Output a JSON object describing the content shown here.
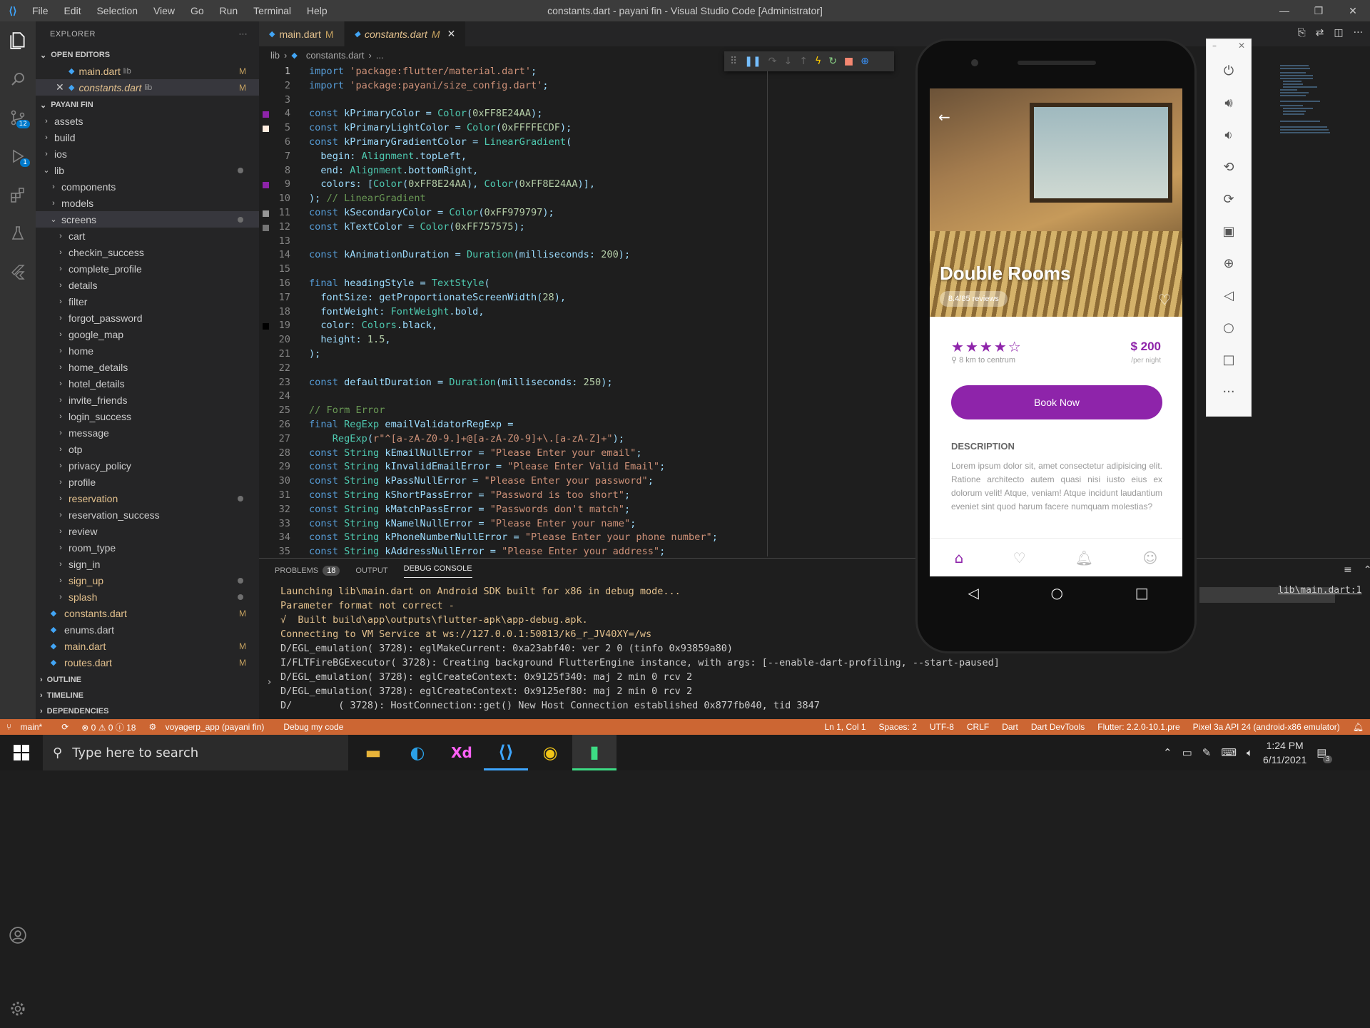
{
  "titlebar": {
    "menu": [
      "File",
      "Edit",
      "Selection",
      "View",
      "Go",
      "Run",
      "Terminal",
      "Help"
    ],
    "title": "constants.dart - payani fin - Visual Studio Code [Administrator]"
  },
  "explorer": {
    "header": "EXPLORER",
    "open_editors_label": "OPEN EDITORS",
    "open_editors": [
      {
        "name": "main.dart",
        "dir": "lib",
        "mark": "M"
      },
      {
        "name": "constants.dart",
        "dir": "lib",
        "mark": "M"
      }
    ],
    "project_label": "PAYANI FIN",
    "tree": [
      {
        "name": "assets",
        "folder": true,
        "level": 0
      },
      {
        "name": "build",
        "folder": true,
        "level": 0
      },
      {
        "name": "ios",
        "folder": true,
        "level": 0
      },
      {
        "name": "lib",
        "folder": true,
        "level": 0,
        "open": true,
        "dot": true
      },
      {
        "name": "components",
        "folder": true,
        "level": 1
      },
      {
        "name": "models",
        "folder": true,
        "level": 1
      },
      {
        "name": "screens",
        "folder": true,
        "level": 1,
        "open": true,
        "dot": true,
        "selected": true
      },
      {
        "name": "cart",
        "folder": true,
        "level": 2
      },
      {
        "name": "checkin_success",
        "folder": true,
        "level": 2
      },
      {
        "name": "complete_profile",
        "folder": true,
        "level": 2
      },
      {
        "name": "details",
        "folder": true,
        "level": 2
      },
      {
        "name": "filter",
        "folder": true,
        "level": 2
      },
      {
        "name": "forgot_password",
        "folder": true,
        "level": 2
      },
      {
        "name": "google_map",
        "folder": true,
        "level": 2
      },
      {
        "name": "home",
        "folder": true,
        "level": 2
      },
      {
        "name": "home_details",
        "folder": true,
        "level": 2
      },
      {
        "name": "hotel_details",
        "folder": true,
        "level": 2
      },
      {
        "name": "invite_friends",
        "folder": true,
        "level": 2
      },
      {
        "name": "login_success",
        "folder": true,
        "level": 2
      },
      {
        "name": "message",
        "folder": true,
        "level": 2
      },
      {
        "name": "otp",
        "folder": true,
        "level": 2
      },
      {
        "name": "privacy_policy",
        "folder": true,
        "level": 2
      },
      {
        "name": "profile",
        "folder": true,
        "level": 2
      },
      {
        "name": "reservation",
        "folder": true,
        "level": 2,
        "dot": true,
        "gold": true
      },
      {
        "name": "reservation_success",
        "folder": true,
        "level": 2
      },
      {
        "name": "review",
        "folder": true,
        "level": 2
      },
      {
        "name": "room_type",
        "folder": true,
        "level": 2
      },
      {
        "name": "sign_in",
        "folder": true,
        "level": 2
      },
      {
        "name": "sign_up",
        "folder": true,
        "level": 2,
        "dot": true,
        "gold": true
      },
      {
        "name": "splash",
        "folder": true,
        "level": 2,
        "dot": true,
        "gold": true
      },
      {
        "name": "constants.dart",
        "folder": false,
        "level": 1,
        "mark": "M",
        "gold": true
      },
      {
        "name": "enums.dart",
        "folder": false,
        "level": 1
      },
      {
        "name": "main.dart",
        "folder": false,
        "level": 1,
        "mark": "M",
        "gold": true
      },
      {
        "name": "routes.dart",
        "folder": false,
        "level": 1,
        "mark": "M",
        "gold": true
      }
    ],
    "bottom_sections": [
      "OUTLINE",
      "TIMELINE",
      "DEPENDENCIES"
    ]
  },
  "tabs": [
    {
      "name": "main.dart",
      "mark": "M"
    },
    {
      "name": "constants.dart",
      "mark": "M",
      "active": true
    }
  ],
  "breadcrumb": [
    "lib",
    "constants.dart",
    "..."
  ],
  "code_lines": [
    "import 'package:flutter/material.dart';",
    "import 'package:payani/size_config.dart';",
    "",
    "const kPrimaryColor = Color(0xFF8E24AA);",
    "const kPrimaryLightColor = Color(0xFFFFECDF);",
    "const kPrimaryGradientColor = LinearGradient(",
    "  begin: Alignment.topLeft,",
    "  end: Alignment.bottomRight,",
    "  colors: [Color(0xFF8E24AA), Color(0xFF8E24AA)],",
    "); // LinearGradient",
    "const kSecondaryColor = Color(0xFF979797);",
    "const kTextColor = Color(0xFF757575);",
    "",
    "const kAnimationDuration = Duration(milliseconds: 200);",
    "",
    "final headingStyle = TextStyle(",
    "  fontSize: getProportionateScreenWidth(28),",
    "  fontWeight: FontWeight.bold,",
    "  color: Colors.black,",
    "  height: 1.5,",
    ");",
    "",
    "const defaultDuration = Duration(milliseconds: 250);",
    "",
    "// Form Error",
    "final RegExp emailValidatorRegExp =",
    "    RegExp(r\"^[a-zA-Z0-9.]+@[a-zA-Z0-9]+\\.[a-zA-Z]+\");",
    "const String kEmailNullError = \"Please Enter your email\";",
    "const String kInvalidEmailError = \"Please Enter Valid Email\";",
    "const String kPassNullError = \"Please Enter your password\";",
    "const String kShortPassError = \"Password is too short\";",
    "const String kMatchPassError = \"Passwords don't match\";",
    "const String kNamelNullError = \"Please Enter your name\";",
    "const String kPhoneNumberNullError = \"Please Enter your phone number\";",
    "const String kAddressNullError = \"Please Enter your address\";"
  ],
  "gutter_swatches": [
    {
      "line": 4,
      "color": "#8E24AA"
    },
    {
      "line": 5,
      "color": "#FFECDF"
    },
    {
      "line": 9,
      "color": "#8E24AA"
    },
    {
      "line": 11,
      "color": "#979797"
    },
    {
      "line": 12,
      "color": "#757575"
    },
    {
      "line": 19,
      "color": "#000000"
    }
  ],
  "panel": {
    "tabs": [
      "PROBLEMS",
      "OUTPUT",
      "DEBUG CONSOLE"
    ],
    "problems_count": "18",
    "active_tab": "DEBUG CONSOLE",
    "console": [
      "Launching lib\\main.dart on Android SDK built for x86 in debug mode...",
      "Parameter format not correct -",
      "√  Built build\\app\\outputs\\flutter-apk\\app-debug.apk.",
      "Connecting to VM Service at ws://127.0.0.1:50813/k6_r_JV40XY=/ws",
      "D/EGL_emulation( 3728): eglMakeCurrent: 0xa23abf40: ver 2 0 (tinfo 0x93859a80)",
      "I/FLTFireBGExecutor( 3728): Creating background FlutterEngine instance, with args: [--enable-dart-profiling, --start-paused]",
      "D/EGL_emulation( 3728): eglCreateContext: 0x9125f340: maj 2 min 0 rcv 2",
      "D/EGL_emulation( 3728): eglCreateContext: 0x9125ef80: maj 2 min 0 rcv 2",
      "D/        ( 3728): HostConnection::get() New Host Connection established 0x877fb040, tid 3847"
    ],
    "link": "lib\\main.dart:1"
  },
  "statusbar": {
    "left": [
      "main*",
      "⊗ 0 ⚠ 0 ⓘ 18",
      "voyagerp_app (payani fin)",
      "Debug my code"
    ],
    "right": [
      "Ln 1, Col 1",
      "Spaces: 2",
      "UTF-8",
      "CRLF",
      "Dart",
      "Dart DevTools",
      "Flutter: 2.2.0-10.1.pre",
      "Pixel 3a API 24 (android-x86 emulator)"
    ]
  },
  "phone": {
    "title": "Double Rooms",
    "reviews": "8.4/85 reviews",
    "rating": 4,
    "rating_max": 5,
    "distance": "8 km to centrum",
    "price": "$ 200",
    "per_night": "/per night",
    "book_button": "Book Now",
    "description_label": "DESCRIPTION",
    "description": "Lorem ipsum dolor sit, amet consectetur adipisicing elit. Ratione architecto autem quasi nisi iusto eius ex dolorum velit! Atque, veniam! Atque incidunt laudantium eveniet sint quod harum facere numquam molestias?",
    "accent": "#8E24AA"
  },
  "taskbar": {
    "search_placeholder": "Type here to search",
    "time": "1:24 PM",
    "date": "6/11/2021",
    "notifications": "3"
  }
}
